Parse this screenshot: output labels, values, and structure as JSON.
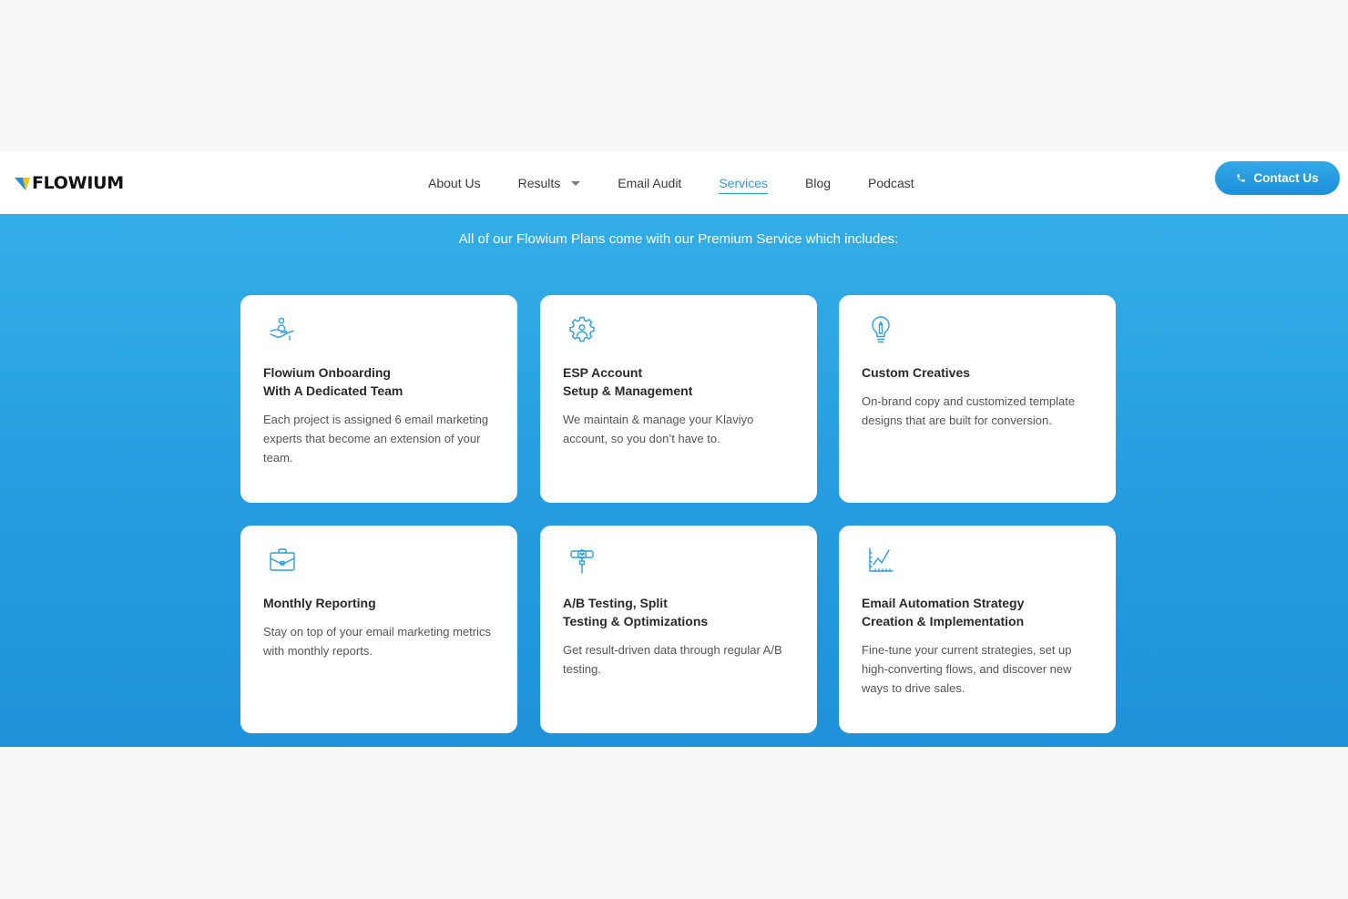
{
  "brand": {
    "name": "FLOWIUM"
  },
  "nav": {
    "items": [
      {
        "label": "About Us"
      },
      {
        "label": "Results"
      },
      {
        "label": "Email Audit"
      },
      {
        "label": "Services"
      },
      {
        "label": "Blog"
      },
      {
        "label": "Podcast"
      }
    ],
    "active": "Services"
  },
  "contact": {
    "label": "Contact Us"
  },
  "section": {
    "intro": "All of our Flowium Plans come with our Premium Service which includes:"
  },
  "cards": [
    {
      "icon": "hand-person-icon",
      "title1": "Flowium Onboarding",
      "title2": "With A Dedicated Team",
      "desc": "Each project is assigned 6 email marketing experts that become an extension of your team."
    },
    {
      "icon": "gear-person-icon",
      "title1": "ESP Account",
      "title2": "Setup & Management",
      "desc": "We maintain & manage your Klaviyo account, so you don’t have to."
    },
    {
      "icon": "lightbulb-pencil-icon",
      "title1": "Custom Creatives",
      "title2": "",
      "desc": "On-brand copy and customized template designs that are built for conversion."
    },
    {
      "icon": "briefcase-icon",
      "title1": "Monthly Reporting",
      "title2": "",
      "desc": "Stay on top of your email marketing metrics with monthly reports."
    },
    {
      "icon": "testing-icon",
      "title1": "A/B Testing, Split",
      "title2": "Testing & Optimizations",
      "desc": "Get result-driven data through regular A/B testing."
    },
    {
      "icon": "line-chart-icon",
      "title1": "Email Automation Strategy",
      "title2": "Creation & Implementation",
      "desc": "Fine-tune your current strategies, set up high-converting flows, and discover new ways to drive sales."
    }
  ],
  "colors": {
    "accent": "#2b9ee0",
    "button": "#1c8fdb",
    "logo_yellow": "#f5c400"
  }
}
